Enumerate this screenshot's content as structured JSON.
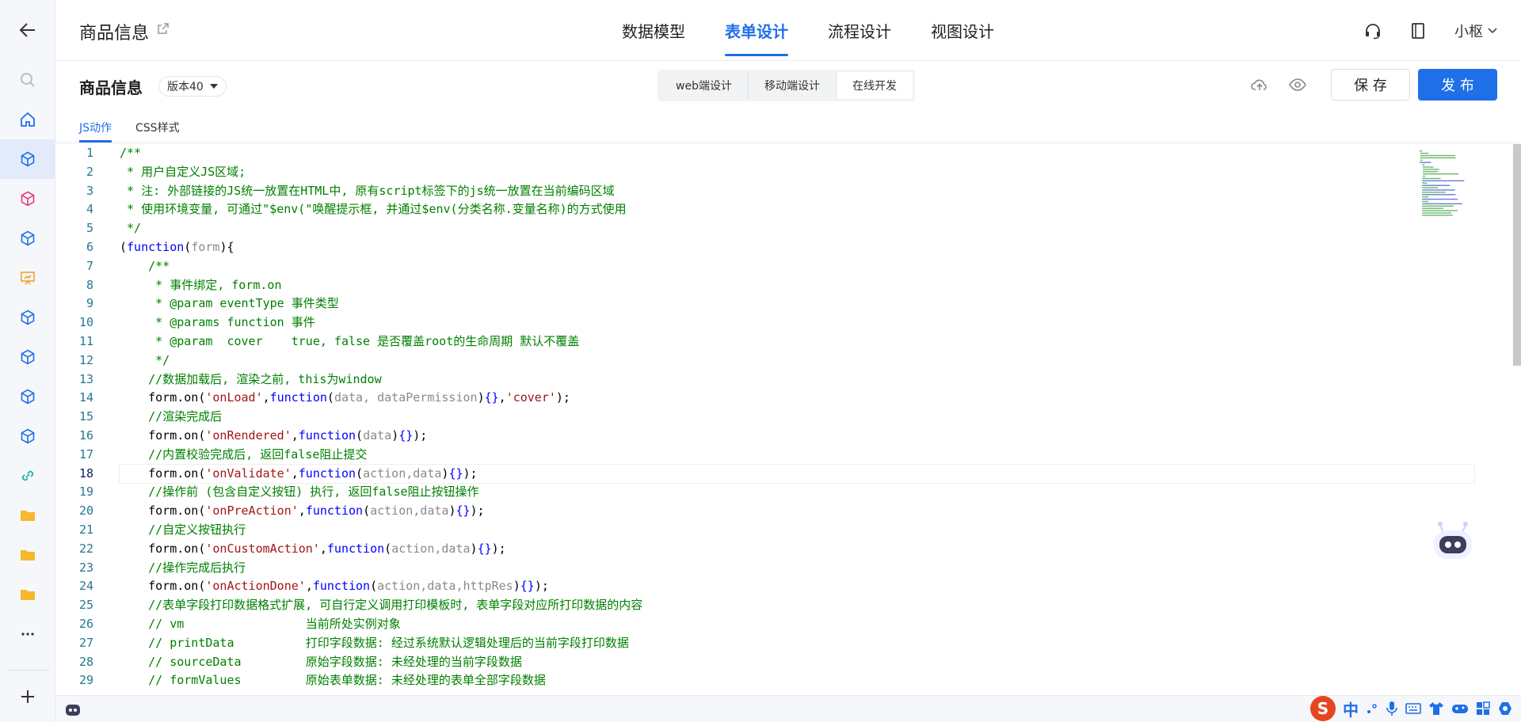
{
  "header": {
    "app_title": "商品信息",
    "nav": [
      "数据模型",
      "表单设计",
      "流程设计",
      "视图设计"
    ],
    "active_nav": 1,
    "user": "小枢"
  },
  "subheader": {
    "form_title": "商品信息",
    "version": "版本40",
    "design_modes": [
      "web端设计",
      "移动端设计",
      "在线开发"
    ],
    "active_mode": 2,
    "save_label": "保 存",
    "publish_label": "发 布",
    "tabs": [
      "JS动作",
      "CSS样式"
    ],
    "active_tab": 0
  },
  "editor": {
    "current_line": 18,
    "lines": [
      "/**",
      " * 用户自定义JS区域;",
      " * 注: 外部链接的JS统一放置在HTML中, 原有script标签下的js统一放置在当前编码区域",
      " * 使用环境变量, 可通过\"$env(\"唤醒提示框, 并通过$env(分类名称.变量名称)的方式使用",
      " */",
      "(function(form){",
      "    /**",
      "     * 事件绑定, form.on",
      "     * @param eventType 事件类型",
      "     * @params function 事件",
      "     * @param  cover    true, false 是否覆盖root的生命周期 默认不覆盖",
      "     */",
      "    //数据加载后, 渲染之前, this为window",
      "    form.on('onLoad',function(data, dataPermission){},'cover');",
      "    //渲染完成后",
      "    form.on('onRendered',function(data){});",
      "    //内置校验完成后, 返回false阻止提交",
      "    form.on('onValidate',function(action,data){});",
      "    //操作前 (包含自定义按钮) 执行, 返回false阻止按钮操作",
      "    form.on('onPreAction',function(action,data){});",
      "    //自定义按钮执行",
      "    form.on('onCustomAction',function(action,data){});",
      "    //操作完成后执行",
      "    form.on('onActionDone',function(action,data,httpRes){});",
      "    //表单字段打印数据格式扩展, 可自行定义调用打印模板时, 表单字段对应所打印数据的内容",
      "    // vm                 当前所处实例对象",
      "    // printData          打印字段数据: 经过系统默认逻辑处理后的当前字段打印数据",
      "    // sourceData         原始字段数据: 未经处理的当前字段数据",
      "    // formValues         原始表单数据: 未经处理的表单全部字段数据"
    ]
  },
  "ime": {
    "logo": "S",
    "lang": "中"
  }
}
